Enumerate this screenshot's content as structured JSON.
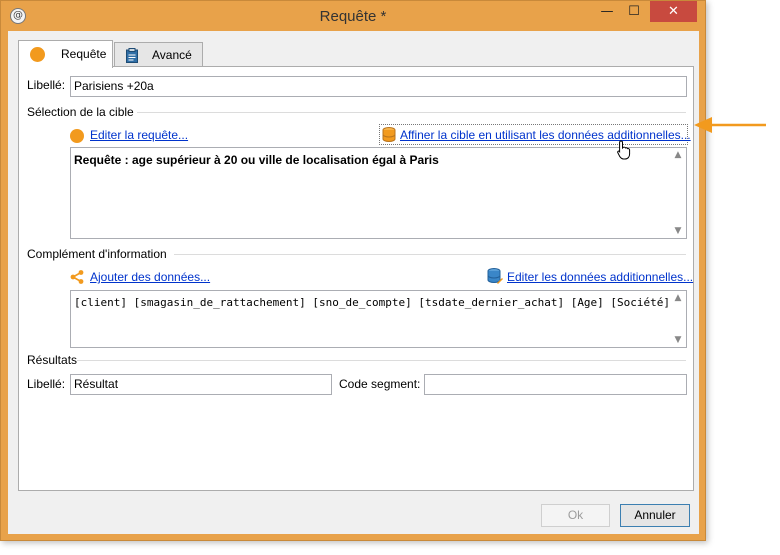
{
  "window": {
    "title": "Requête *",
    "minimize": "—",
    "maximize": "☐",
    "close": "✕",
    "app_icon": "adobe-campaign-icon"
  },
  "tabs": [
    {
      "label": "Requête",
      "icon": "orange-circle-icon",
      "active": true
    },
    {
      "label": "Avancé",
      "icon": "clipboard-icon",
      "active": false
    }
  ],
  "libelle": {
    "label": "Libellé:",
    "value": "Parisiens +20a"
  },
  "selection": {
    "heading": "Sélection de la cible",
    "edit_query_link": "Editer la requête...",
    "refine_link": "Affiner la cible en utilisant les données additionnelles...",
    "query_text": "Requête : age supérieur à 20 ou ville de localisation égal à Paris"
  },
  "complement": {
    "heading": "Complément d'information",
    "add_data_link": "Ajouter des données...",
    "edit_additional_link": "Editer les données additionnelles...",
    "fields_text": "[client] [smagasin_de_rattachement] [sno_de_compte] [tsdate_dernier_achat] [Age] [Société]"
  },
  "resultats": {
    "heading": "Résultats",
    "libelle_label": "Libellé:",
    "libelle_value": "Résultat",
    "code_label": "Code segment:",
    "code_value": ""
  },
  "buttons": {
    "ok": "Ok",
    "cancel": "Annuler"
  },
  "colors": {
    "accent_orange": "#f29a1e",
    "link": "#0033cc",
    "frame": "#e8a24a"
  }
}
